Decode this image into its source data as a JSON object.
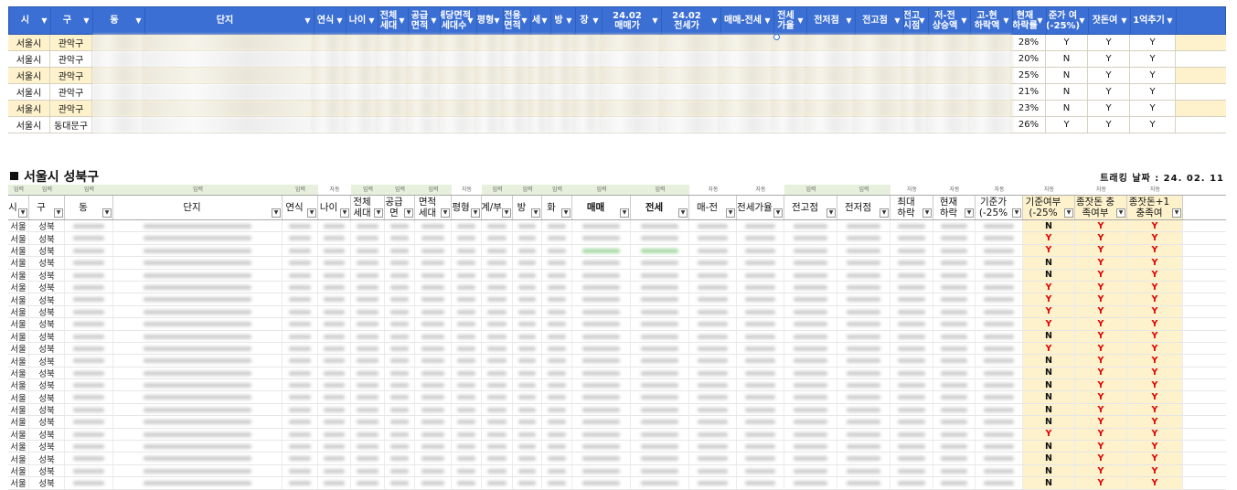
{
  "top_table": {
    "headers": [
      "시",
      "구",
      "동",
      "단지",
      "연식",
      "나이",
      "전체\n세대",
      "공급\n면적",
      "해당면적\n세대수",
      "평형",
      "전용\n면적",
      "세",
      "방",
      "장",
      "24.02\n매매가",
      "24.02\n전세가",
      "매매-전세",
      "전세\n가율",
      "전저점",
      "전고점",
      "전고\n시점",
      "저-전\n상승액",
      "고-현\n하락액",
      "현재\n하락률",
      "준가 여\n(-25%)",
      "잣돈여",
      "1억추기"
    ],
    "rows": [
      {
        "si": "서울시",
        "gu": "관악구",
        "drop": "28%",
        "base": "Y",
        "money": "Y",
        "plus": "Y",
        "alt": true
      },
      {
        "si": "서울시",
        "gu": "관악구",
        "drop": "20%",
        "base": "N",
        "money": "Y",
        "plus": "Y",
        "alt": false
      },
      {
        "si": "서울시",
        "gu": "관악구",
        "drop": "25%",
        "base": "N",
        "money": "Y",
        "plus": "Y",
        "alt": true
      },
      {
        "si": "서울시",
        "gu": "관악구",
        "drop": "21%",
        "base": "N",
        "money": "Y",
        "plus": "Y",
        "alt": false
      },
      {
        "si": "서울시",
        "gu": "관악구",
        "drop": "23%",
        "base": "N",
        "money": "Y",
        "plus": "Y",
        "alt": true
      },
      {
        "si": "서울시",
        "gu": "동대문구",
        "drop": "26%",
        "base": "Y",
        "money": "Y",
        "plus": "Y",
        "alt": false
      }
    ]
  },
  "section": {
    "title": "서울시 성북구",
    "tracking_date": "트래킹 날짜 : 24. 02. 11",
    "tags": [
      "입력",
      "입력",
      "입력",
      "입력",
      "입력",
      "자동",
      "입력",
      "입력",
      "입력",
      "자동",
      "입력",
      "입력",
      "입력",
      "입력",
      "입력",
      "자동",
      "자동",
      "입력",
      "입력",
      "자동",
      "자동",
      "자동",
      "자동",
      "자동",
      "자동"
    ],
    "headers": [
      "시",
      "구",
      "동",
      "단지",
      "연식",
      "나이",
      "전체\n세대",
      "공급\n면",
      "면적\n세대",
      "평형",
      "계/부",
      "방",
      "화",
      "매매",
      "전세",
      "매-전",
      "전세가율",
      "전고점",
      "전저점",
      "최대\n하락",
      "현재\n하락",
      "기준가\n(-25%",
      "기준여부\n(-25%",
      "종잣돈 충\n족여부",
      "종잣돈+1\n충족여"
    ],
    "rows": [
      {
        "si": "서울",
        "gu": "성북",
        "a": "N",
        "b": "Y",
        "c": "Y"
      },
      {
        "si": "서울",
        "gu": "성북",
        "a": "Y",
        "b": "Y",
        "c": "Y"
      },
      {
        "si": "서울",
        "gu": "성북",
        "a": "Y",
        "b": "Y",
        "c": "Y"
      },
      {
        "si": "서울",
        "gu": "성북",
        "a": "N",
        "b": "Y",
        "c": "Y"
      },
      {
        "si": "서울",
        "gu": "성북",
        "a": "N",
        "b": "Y",
        "c": "Y"
      },
      {
        "si": "서울",
        "gu": "성북",
        "a": "Y",
        "b": "Y",
        "c": "Y"
      },
      {
        "si": "서울",
        "gu": "성북",
        "a": "Y",
        "b": "Y",
        "c": "Y"
      },
      {
        "si": "서울",
        "gu": "성북",
        "a": "Y",
        "b": "Y",
        "c": "Y"
      },
      {
        "si": "서울",
        "gu": "성북",
        "a": "Y",
        "b": "Y",
        "c": "Y"
      },
      {
        "si": "서울",
        "gu": "성북",
        "a": "N",
        "b": "Y",
        "c": "Y"
      },
      {
        "si": "서울",
        "gu": "성북",
        "a": "Y",
        "b": "Y",
        "c": "Y"
      },
      {
        "si": "서울",
        "gu": "성북",
        "a": "N",
        "b": "Y",
        "c": "Y"
      },
      {
        "si": "서울",
        "gu": "성북",
        "a": "N",
        "b": "Y",
        "c": "Y"
      },
      {
        "si": "서울",
        "gu": "성북",
        "a": "N",
        "b": "Y",
        "c": "Y"
      },
      {
        "si": "서울",
        "gu": "성북",
        "a": "N",
        "b": "Y",
        "c": "Y"
      },
      {
        "si": "서울",
        "gu": "성북",
        "a": "N",
        "b": "Y",
        "c": "Y"
      },
      {
        "si": "서울",
        "gu": "성북",
        "a": "N",
        "b": "Y",
        "c": "Y"
      },
      {
        "si": "서울",
        "gu": "성북",
        "a": "Y",
        "b": "Y",
        "c": "Y"
      },
      {
        "si": "서울",
        "gu": "성북",
        "a": "N",
        "b": "Y",
        "c": "Y"
      },
      {
        "si": "서울",
        "gu": "성북",
        "a": "N",
        "b": "Y",
        "c": "Y"
      },
      {
        "si": "서울",
        "gu": "성북",
        "a": "N",
        "b": "Y",
        "c": "Y"
      },
      {
        "si": "서울",
        "gu": "성북",
        "a": "N",
        "b": "Y",
        "c": "Y"
      }
    ]
  },
  "colors": {
    "header_blue": "#3b6fd4",
    "highlight_yellow": "#fdf2cc",
    "red": "#e00000",
    "input_green": "#e6f0dc"
  },
  "icons": {
    "filter": "filter-dropdown-icon",
    "bullet": "square-bullet-icon"
  }
}
